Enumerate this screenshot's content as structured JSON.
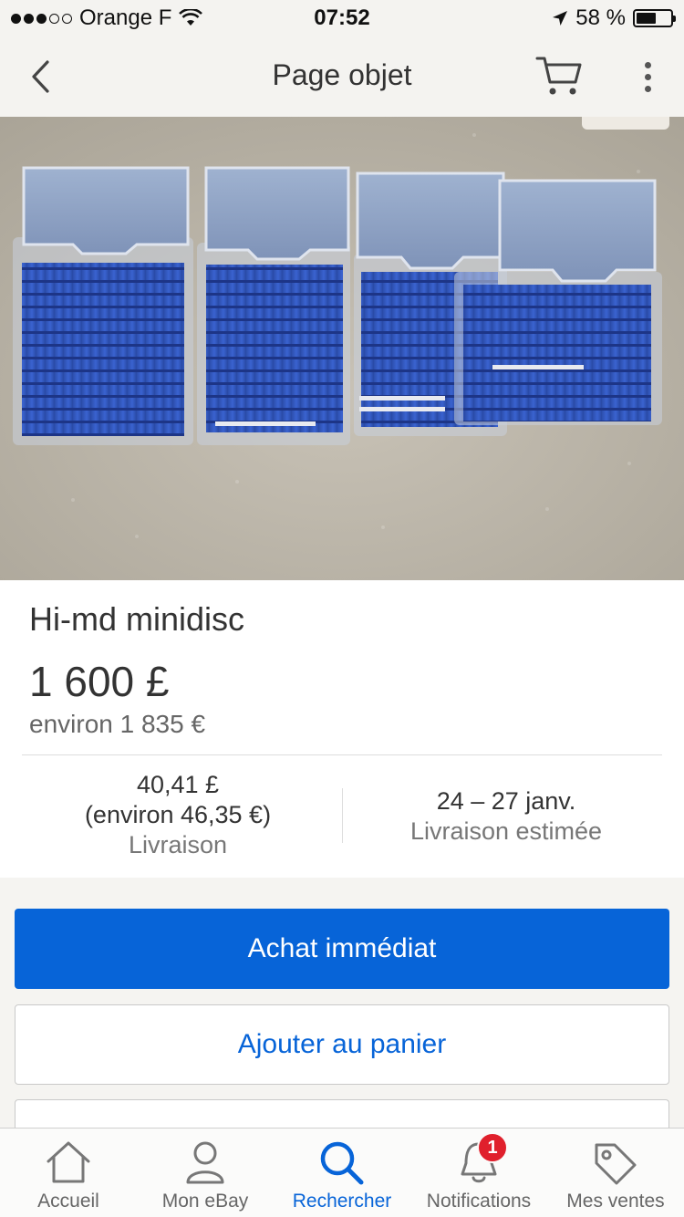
{
  "status_bar": {
    "carrier": "Orange F",
    "time": "07:52",
    "battery": "58 %",
    "battery_level": 0.58
  },
  "nav": {
    "title": "Page objet"
  },
  "item": {
    "title": "Hi-md minidisc",
    "price": "1 600 £",
    "price_approx": "environ 1 835 €",
    "shipping_cost": "40,41 £",
    "shipping_cost_approx": "(environ 46,35 €)",
    "shipping_label": "Livraison",
    "delivery_dates": "24 – 27 janv.",
    "delivery_label": "Livraison estimée"
  },
  "buttons": {
    "buy_now": "Achat immédiat",
    "add_to_cart": "Ajouter au panier"
  },
  "tabs": [
    {
      "label": "Accueil",
      "icon": "home-icon"
    },
    {
      "label": "Mon eBay",
      "icon": "user-icon"
    },
    {
      "label": "Rechercher",
      "icon": "search-icon"
    },
    {
      "label": "Notifications",
      "icon": "bell-icon",
      "badge": "1"
    },
    {
      "label": "Mes ventes",
      "icon": "tag-icon"
    }
  ],
  "colors": {
    "accent": "#0764d8",
    "badge": "#e0202c"
  }
}
